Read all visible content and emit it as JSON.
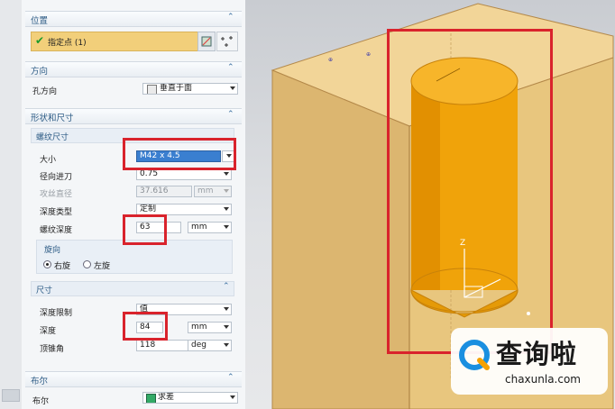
{
  "position": {
    "title": "位置",
    "point_label": "指定点 (1)"
  },
  "direction": {
    "title": "方向",
    "hole_dir_label": "孔方向",
    "hole_dir_value": "垂直于面"
  },
  "shape": {
    "title": "形状和尺寸",
    "thread": {
      "title": "螺纹尺寸",
      "size_label": "大小",
      "size_value": "M42 x 4.5",
      "radial_label": "径向进刀",
      "radial_value": "0.75",
      "tap_label": "攻丝直径",
      "tap_value": "37.616",
      "tap_unit": "mm",
      "depth_type_label": "深度类型",
      "depth_type_value": "定制",
      "thread_depth_label": "螺纹深度",
      "thread_depth_value": "63",
      "thread_depth_unit": "mm",
      "rotation": {
        "title": "旋向",
        "right_label": "右旋",
        "left_label": "左旋"
      }
    },
    "dims": {
      "title": "尺寸",
      "limit_label": "深度限制",
      "limit_value": "值",
      "depth_label": "深度",
      "depth_value": "84",
      "depth_unit": "mm",
      "tip_label": "顶锥角",
      "tip_value": "118",
      "tip_unit": "deg"
    }
  },
  "boolean": {
    "title": "布尔",
    "label": "布尔",
    "value": "求差"
  },
  "watermark": {
    "main": "查询啦",
    "url": "chaxunla.com"
  },
  "colors": {
    "accent_red": "#d9232c",
    "solid_orange": "#f0a30a",
    "block_tan": "#e8c780",
    "header_blue": "#2b5a84"
  }
}
